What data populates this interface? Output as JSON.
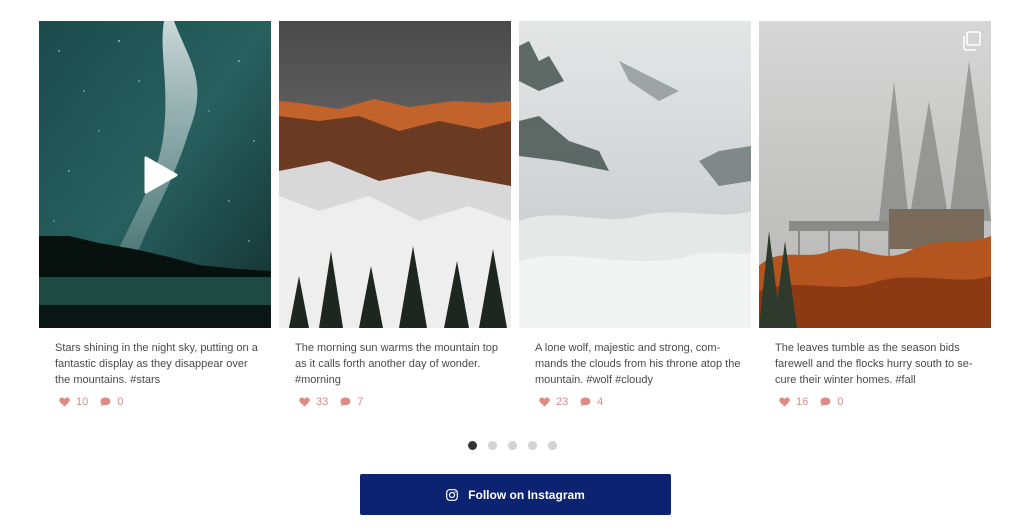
{
  "posts": [
    {
      "caption": "Stars shining in the night sky, putting on a fantastic display as they disappear over the mountains. #stars",
      "likes": "10",
      "comments": "0",
      "media_icon": "play-icon"
    },
    {
      "caption": "The morning sun warms the mountain top as it calls forth another day of wonder. #morning",
      "likes": "33",
      "comments": "7",
      "media_icon": ""
    },
    {
      "caption": "A lone wolf, majestic and strong, com-mands the clouds from his throne atop the mountain. #wolf #cloudy",
      "likes": "23",
      "comments": "4",
      "media_icon": ""
    },
    {
      "caption": "The leaves tumble as the season bids farewell and the flocks hurry south to se-cure their winter homes. #fall",
      "likes": "16",
      "comments": "0",
      "media_icon": "gallery-icon"
    }
  ],
  "carousel": {
    "pages": 5,
    "active_page": 1
  },
  "follow_button": {
    "label": "Follow on Instagram",
    "icon": "instagram-icon"
  },
  "colors": {
    "accent": "#0b2370",
    "meta": "#d98c85",
    "dot_active": "#333333",
    "dot_inactive": "#d3d3d3"
  }
}
